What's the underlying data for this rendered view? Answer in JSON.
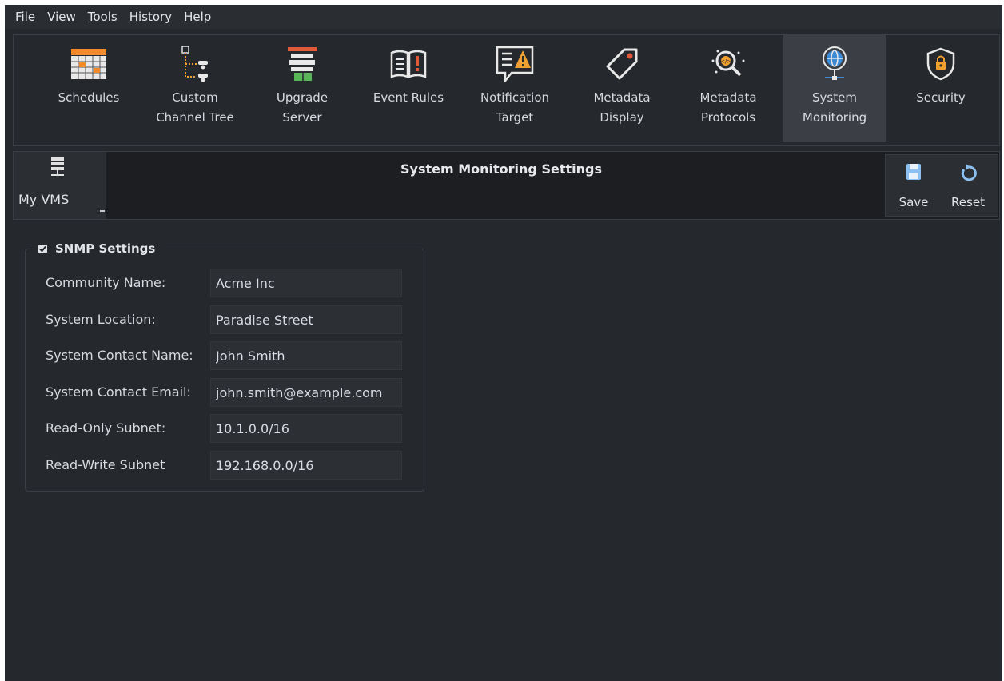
{
  "menu": [
    {
      "underline": "F",
      "rest": "ile"
    },
    {
      "underline": "V",
      "rest": "iew"
    },
    {
      "underline": "T",
      "rest": "ools"
    },
    {
      "underline": "H",
      "rest": "istory"
    },
    {
      "underline": "H",
      "rest": "elp"
    }
  ],
  "toolbar": {
    "active": "System Monitoring",
    "items": [
      {
        "label": "Schedules",
        "icon": "schedule-calendar-icon"
      },
      {
        "label": "Custom\nChannel Tree",
        "icon": "channel-tree-icon"
      },
      {
        "label": "Upgrade\nServer",
        "icon": "upgrade-server-icon"
      },
      {
        "label": "Event Rules",
        "icon": "event-rules-book-icon"
      },
      {
        "label": "Notification\nTarget",
        "icon": "notification-target-icon"
      },
      {
        "label": "Metadata\nDisplay",
        "icon": "metadata-tag-icon"
      },
      {
        "label": "Metadata\nProtocols",
        "icon": "metadata-protocols-icon"
      },
      {
        "label": "System\nMonitoring",
        "icon": "system-monitoring-globe-icon"
      },
      {
        "label": "Security",
        "icon": "security-shield-lock-icon"
      }
    ]
  },
  "header": {
    "server_label": "My VMS",
    "title": "System Monitoring Settings",
    "save_label": "Save",
    "reset_label": "Reset"
  },
  "snmp": {
    "legend": "SNMP Settings",
    "enabled": true,
    "fields": [
      {
        "label": "Community Name:",
        "value": "Acme Inc"
      },
      {
        "label": "System Location:",
        "value": "Paradise Street"
      },
      {
        "label": "System Contact Name:",
        "value": "John Smith"
      },
      {
        "label": "System Contact Email:",
        "value": "john.smith@example.com"
      },
      {
        "label": "Read-Only Subnet:",
        "value": "10.1.0.0/16"
      },
      {
        "label": "Read-Write Subnet",
        "value": "192.168.0.0/16"
      }
    ]
  },
  "colors": {
    "background": "#25282d",
    "accent_orange": "#f0a030",
    "accent_blue": "#3b8ad6",
    "accent_green": "#5ab55a"
  }
}
